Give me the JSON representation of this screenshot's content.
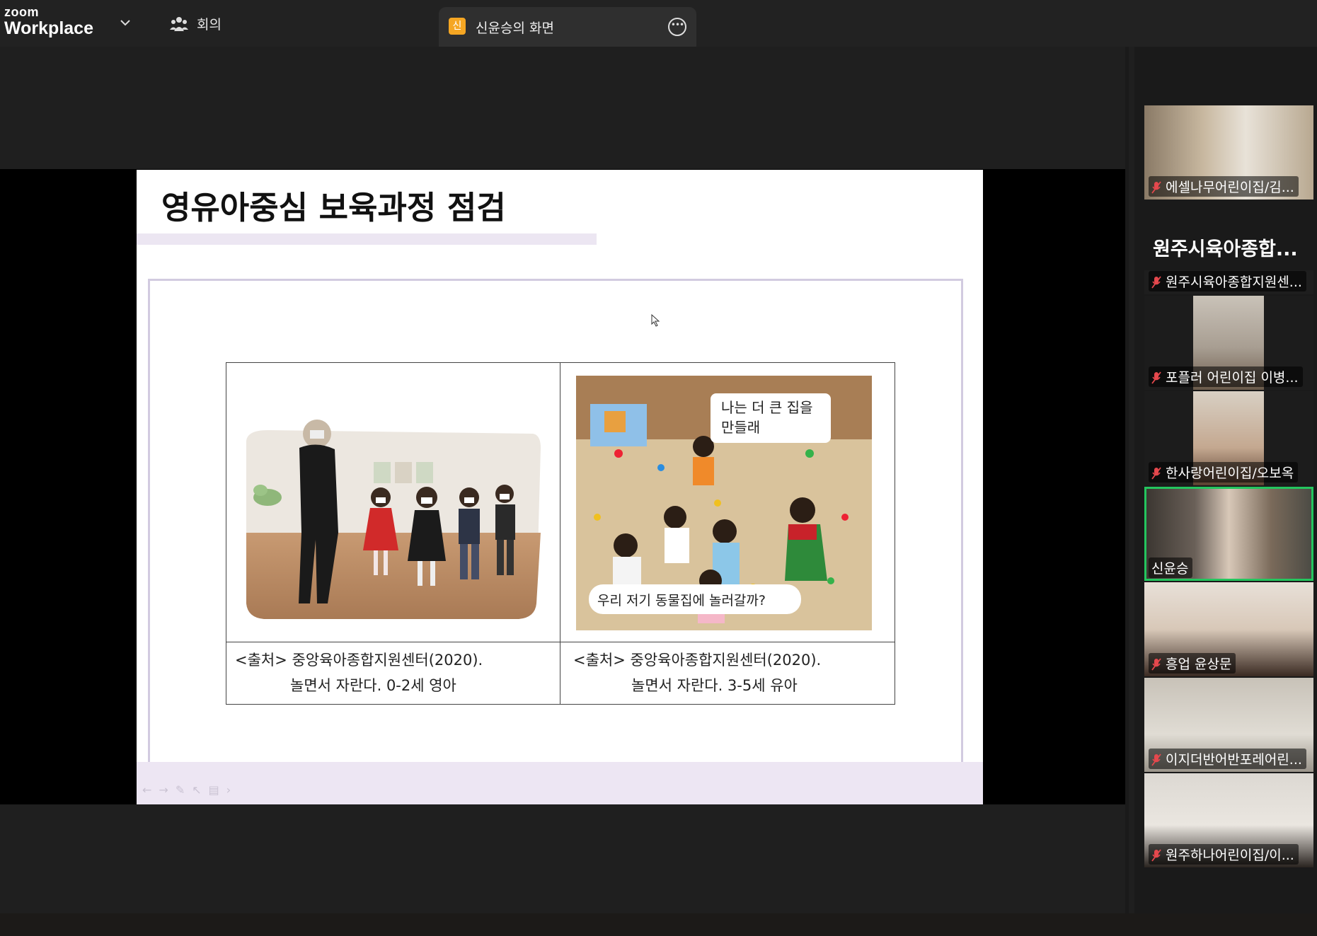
{
  "app": {
    "brand_top": "zoom",
    "brand_bottom": "Workplace"
  },
  "header": {
    "meeting_label": "회의",
    "share_tab": {
      "badge": "신",
      "title": "신윤승의 화면"
    }
  },
  "slide": {
    "title": "영유아중심 보육과정 점검",
    "left_caption": {
      "line1": "<출처> 중앙육아종합지원센터(2020).",
      "line2": "놀면서 자란다. 0-2세 영아"
    },
    "right_caption": {
      "line1": "<출처> 중앙육아종합지원센터(2020).",
      "line2": "놀면서 자란다. 3-5세 유아"
    },
    "bubble_top": {
      "line1": "나는 더 큰 집을",
      "line2": "만들래"
    },
    "bubble_bottom": "우리 저기 동물집에 놀러갈까?"
  },
  "sidebar": {
    "group_title": "원주시육아종합...",
    "participants": [
      {
        "name": "에셀나무어린이집/김...",
        "muted": true
      },
      {
        "name": "원주시육아종합지원센...",
        "muted": true
      },
      {
        "name": "포플러  어린이집 이병...",
        "muted": true
      },
      {
        "name": "한사랑어린이집/오보옥",
        "muted": true
      },
      {
        "name": "신윤승",
        "muted": false,
        "active": true
      },
      {
        "name": "흥업 윤상문",
        "muted": true
      },
      {
        "name": "이지더반어반포레어린...",
        "muted": true
      },
      {
        "name": "원주하나어린이집/이...",
        "muted": true
      }
    ]
  },
  "colors": {
    "active_speaker": "#24c55e",
    "share_badge": "#f5a623",
    "muted_mic": "#e5484d"
  }
}
